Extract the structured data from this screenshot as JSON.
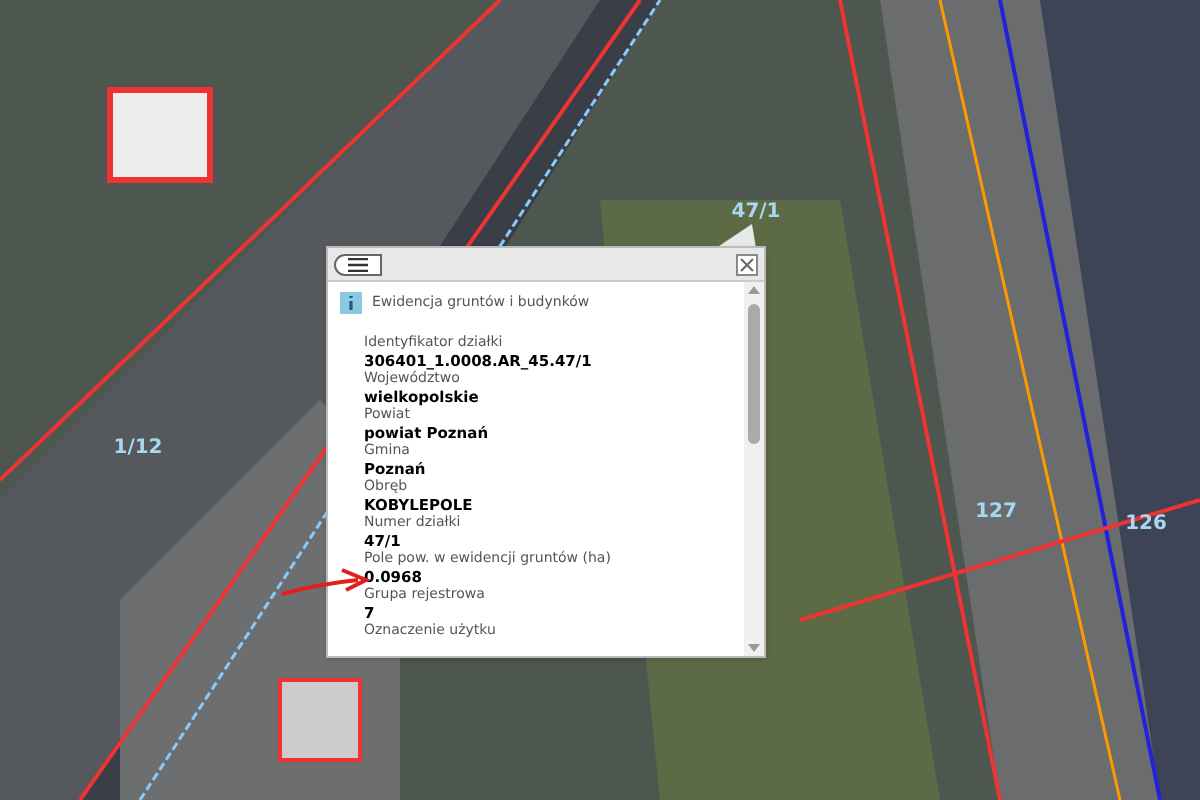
{
  "map_labels": [
    {
      "text": "47/1"
    },
    {
      "text": "1/12"
    },
    {
      "text": "127"
    },
    {
      "text": "126"
    }
  ],
  "popup": {
    "title": "Ewidencja gruntów i budynków",
    "fields": [
      {
        "label": "Identyfikator działki",
        "value": "306401_1.0008.AR_45.47/1"
      },
      {
        "label": "Województwo",
        "value": "wielkopolskie"
      },
      {
        "label": "Powiat",
        "value": "powiat Poznań"
      },
      {
        "label": "Gmina",
        "value": "Poznań"
      },
      {
        "label": "Obręb",
        "value": "KOBYLEPOLE"
      },
      {
        "label": "Numer działki",
        "value": "47/1"
      },
      {
        "label": "Pole pow. w ewidencji gruntów (ha)",
        "value": "0.0968",
        "highlighted": true
      },
      {
        "label": "Grupa rejestrowa",
        "value": "7"
      },
      {
        "label": "Oznaczenie użytku"
      }
    ]
  }
}
